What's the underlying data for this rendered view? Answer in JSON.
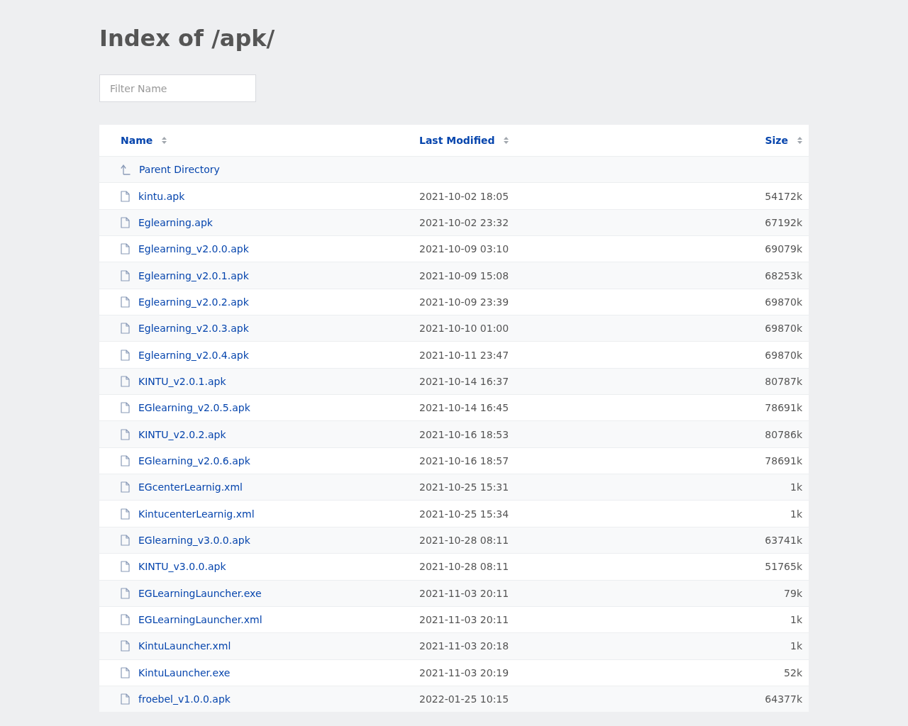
{
  "title": "Index of /apk/",
  "filter": {
    "placeholder": "Filter Name"
  },
  "columns": [
    {
      "label": "Name"
    },
    {
      "label": "Last Modified"
    },
    {
      "label": "Size"
    }
  ],
  "rows": [
    {
      "kind": "parent",
      "name": "Parent Directory",
      "modified": "",
      "size": ""
    },
    {
      "kind": "file",
      "name": "kintu.apk",
      "modified": "2021-10-02 18:05",
      "size": "54172k"
    },
    {
      "kind": "file",
      "name": "Eglearning.apk",
      "modified": "2021-10-02 23:32",
      "size": "67192k"
    },
    {
      "kind": "file",
      "name": "Eglearning_v2.0.0.apk",
      "modified": "2021-10-09 03:10",
      "size": "69079k"
    },
    {
      "kind": "file",
      "name": "Eglearning_v2.0.1.apk",
      "modified": "2021-10-09 15:08",
      "size": "68253k"
    },
    {
      "kind": "file",
      "name": "Eglearning_v2.0.2.apk",
      "modified": "2021-10-09 23:39",
      "size": "69870k"
    },
    {
      "kind": "file",
      "name": "Eglearning_v2.0.3.apk",
      "modified": "2021-10-10 01:00",
      "size": "69870k"
    },
    {
      "kind": "file",
      "name": "Eglearning_v2.0.4.apk",
      "modified": "2021-10-11 23:47",
      "size": "69870k"
    },
    {
      "kind": "file",
      "name": "KINTU_v2.0.1.apk",
      "modified": "2021-10-14 16:37",
      "size": "80787k"
    },
    {
      "kind": "file",
      "name": "EGlearning_v2.0.5.apk",
      "modified": "2021-10-14 16:45",
      "size": "78691k"
    },
    {
      "kind": "file",
      "name": "KINTU_v2.0.2.apk",
      "modified": "2021-10-16 18:53",
      "size": "80786k"
    },
    {
      "kind": "file",
      "name": "EGlearning_v2.0.6.apk",
      "modified": "2021-10-16 18:57",
      "size": "78691k"
    },
    {
      "kind": "file",
      "name": "EGcenterLearnig.xml",
      "modified": "2021-10-25 15:31",
      "size": "1k"
    },
    {
      "kind": "file",
      "name": "KintucenterLearnig.xml",
      "modified": "2021-10-25 15:34",
      "size": "1k"
    },
    {
      "kind": "file",
      "name": "EGlearning_v3.0.0.apk",
      "modified": "2021-10-28 08:11",
      "size": "63741k"
    },
    {
      "kind": "file",
      "name": "KINTU_v3.0.0.apk",
      "modified": "2021-10-28 08:11",
      "size": "51765k"
    },
    {
      "kind": "file",
      "name": "EGLearningLauncher.exe",
      "modified": "2021-11-03 20:11",
      "size": "79k"
    },
    {
      "kind": "file",
      "name": "EGLearningLauncher.xml",
      "modified": "2021-11-03 20:11",
      "size": "1k"
    },
    {
      "kind": "file",
      "name": "KintuLauncher.xml",
      "modified": "2021-11-03 20:18",
      "size": "1k"
    },
    {
      "kind": "file",
      "name": "KintuLauncher.exe",
      "modified": "2021-11-03 20:19",
      "size": "52k"
    },
    {
      "kind": "file",
      "name": "froebel_v1.0.0.apk",
      "modified": "2022-01-25 10:15",
      "size": "64377k"
    }
  ]
}
